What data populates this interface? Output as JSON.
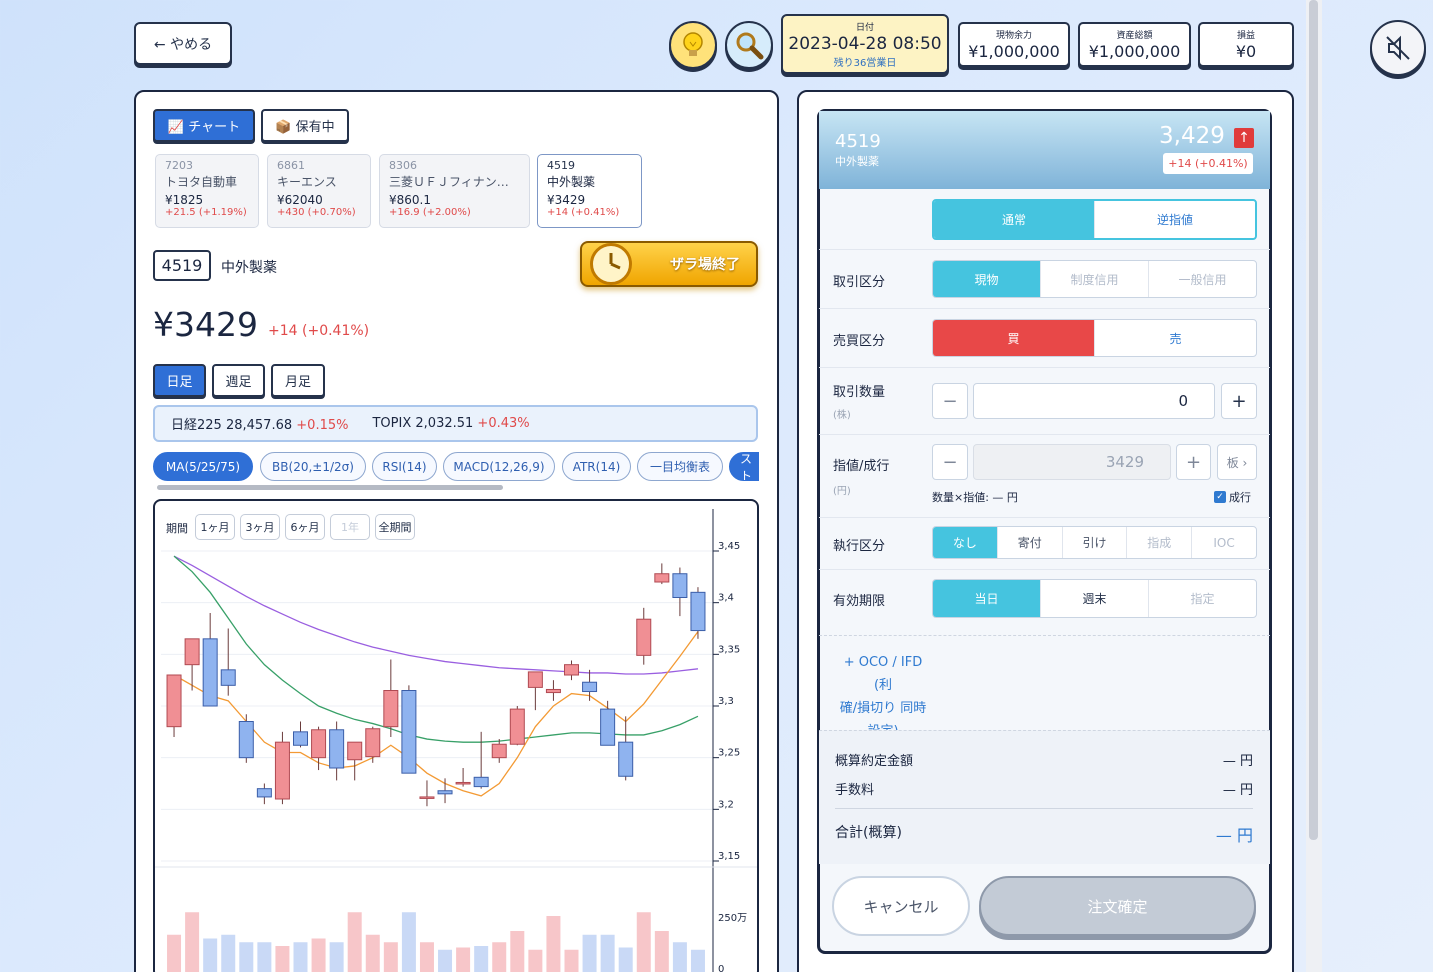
{
  "header": {
    "quit_label": "← やめる",
    "hint_icon": "lightbulb-icon",
    "search_icon": "magnifier-icon",
    "date_label": "日付",
    "date_value": "2023-04-28 08:50",
    "remaining": "残り36営業日",
    "cash_label": "現物余力",
    "cash_value": "¥1,000,000",
    "assets_label": "資産総額",
    "assets_value": "¥1,000,000",
    "pnl_label": "損益",
    "pnl_value": "¥0"
  },
  "left": {
    "tab_chart": "📈 チャート",
    "tab_holdings": "📦 保有中",
    "tickers": [
      {
        "code": "7203",
        "name": "トヨタ自動車",
        "price": "¥1825",
        "change": "+21.5 (+1.19%)"
      },
      {
        "code": "6861",
        "name": "キーエンス",
        "price": "¥62040",
        "change": "+430 (+0.70%)"
      },
      {
        "code": "8306",
        "name": "三菱ＵＦＪフィナン…",
        "price": "¥860.1",
        "change": "+16.9 (+2.00%)"
      },
      {
        "code": "4519",
        "name": "中外製薬",
        "price": "¥3429",
        "change": "+14 (+0.41%)"
      }
    ],
    "code": "4519",
    "name": "中外製薬",
    "market_closed": "ザラ場終了",
    "price": "¥3429",
    "change": "+14 (+0.41%)",
    "periods": [
      "日足",
      "週足",
      "月足"
    ],
    "index_nikkei_label": "日経225",
    "index_nikkei_value": "28,457.68",
    "index_nikkei_change": "+0.15%",
    "index_topix_label": "TOPIX",
    "index_topix_value": "2,032.51",
    "index_topix_change": "+0.43%",
    "indicators": [
      "MA(5/25/75)",
      "BB(20,±1/2σ)",
      "RSI(14)",
      "MACD(12,26,9)",
      "ATR(14)",
      "一目均衡表",
      "スト"
    ],
    "range_label": "期間",
    "ranges": [
      "1ヶ月",
      "3ヶ月",
      "6ヶ月",
      "1年",
      "全期間"
    ]
  },
  "chart_data": {
    "type": "candlestick",
    "y_ticks": [
      "3,45",
      "3,4",
      "3,35",
      "3,3",
      "3,25",
      "3,2",
      "3,15"
    ],
    "volume_ticks": [
      "250万",
      "0"
    ],
    "ylim": [
      3150,
      3450
    ],
    "candles": [
      {
        "o": 3280,
        "h": 3310,
        "l": 3270,
        "c": 3330
      },
      {
        "o": 3340,
        "h": 3360,
        "l": 3315,
        "c": 3365
      },
      {
        "o": 3365,
        "h": 3390,
        "l": 3300,
        "c": 3300
      },
      {
        "o": 3335,
        "h": 3375,
        "l": 3310,
        "c": 3320
      },
      {
        "o": 3285,
        "h": 3292,
        "l": 3245,
        "c": 3250
      },
      {
        "o": 3220,
        "h": 3225,
        "l": 3205,
        "c": 3212
      },
      {
        "o": 3210,
        "h": 3275,
        "l": 3205,
        "c": 3265
      },
      {
        "o": 3275,
        "h": 3285,
        "l": 3260,
        "c": 3262
      },
      {
        "o": 3250,
        "h": 3280,
        "l": 3238,
        "c": 3277
      },
      {
        "o": 3277,
        "h": 3285,
        "l": 3228,
        "c": 3240
      },
      {
        "o": 3248,
        "h": 3262,
        "l": 3228,
        "c": 3265
      },
      {
        "o": 3251,
        "h": 3280,
        "l": 3245,
        "c": 3278
      },
      {
        "o": 3280,
        "h": 3345,
        "l": 3270,
        "c": 3315
      },
      {
        "o": 3315,
        "h": 3320,
        "l": 3235,
        "c": 3235
      },
      {
        "o": 3212,
        "h": 3228,
        "l": 3203,
        "c": 3212
      },
      {
        "o": 3218,
        "h": 3230,
        "l": 3206,
        "c": 3215
      },
      {
        "o": 3225,
        "h": 3240,
        "l": 3222,
        "c": 3226
      },
      {
        "o": 3231,
        "h": 3275,
        "l": 3220,
        "c": 3222
      },
      {
        "o": 3250,
        "h": 3268,
        "l": 3245,
        "c": 3263
      },
      {
        "o": 3263,
        "h": 3300,
        "l": 3262,
        "c": 3297
      },
      {
        "o": 3318,
        "h": 3330,
        "l": 3296,
        "c": 3333
      },
      {
        "o": 3313,
        "h": 3325,
        "l": 3305,
        "c": 3316
      },
      {
        "o": 3330,
        "h": 3344,
        "l": 3325,
        "c": 3340
      },
      {
        "o": 3323,
        "h": 3335,
        "l": 3305,
        "c": 3314
      },
      {
        "o": 3297,
        "h": 3305,
        "l": 3262,
        "c": 3262
      },
      {
        "o": 3265,
        "h": 3290,
        "l": 3228,
        "c": 3232
      },
      {
        "o": 3349,
        "h": 3395,
        "l": 3340,
        "c": 3384
      },
      {
        "o": 3420,
        "h": 3438,
        "l": 3418,
        "c": 3428
      },
      {
        "o": 3428,
        "h": 3434,
        "l": 3387,
        "c": 3405
      },
      {
        "o": 3410,
        "h": 3415,
        "l": 3365,
        "c": 3373
      }
    ],
    "ma_long": [
      3445,
      3436,
      3426,
      3416,
      3406,
      3397,
      3389,
      3381,
      3374,
      3368,
      3362,
      3357,
      3353,
      3349,
      3346,
      3343,
      3341,
      3339,
      3337,
      3336,
      3335,
      3334,
      3333,
      3332,
      3332,
      3331,
      3331,
      3332,
      3334,
      3336
    ],
    "ma_mid": [
      3445,
      3430,
      3410,
      3385,
      3360,
      3340,
      3325,
      3312,
      3300,
      3293,
      3287,
      3283,
      3278,
      3272,
      3268,
      3266,
      3265,
      3265,
      3266,
      3268,
      3270,
      3272,
      3274,
      3274,
      3273,
      3272,
      3272,
      3276,
      3282,
      3290
    ],
    "ma_short": [
      3330,
      3320,
      3310,
      3305,
      3285,
      3265,
      3255,
      3255,
      3245,
      3240,
      3242,
      3250,
      3262,
      3250,
      3235,
      3225,
      3218,
      3213,
      3225,
      3250,
      3280,
      3300,
      3312,
      3310,
      3298,
      3285,
      3302,
      3325,
      3348,
      3372
    ],
    "volume": [
      0.55,
      0.85,
      0.5,
      0.55,
      0.45,
      0.45,
      0.4,
      0.45,
      0.5,
      0.45,
      0.85,
      0.55,
      0.45,
      0.85,
      0.45,
      0.35,
      0.38,
      0.4,
      0.45,
      0.6,
      0.35,
      0.8,
      0.35,
      0.55,
      0.55,
      0.38,
      0.85,
      0.6,
      0.45,
      0.35
    ],
    "colors": {
      "up": "#f08f94",
      "down": "#8fb3ef",
      "ma_long": "#9a5fe0",
      "ma_mid": "#38a068",
      "ma_short": "#f39a34",
      "vol_up": "#f7c6c9",
      "vol_down": "#c9d9f6"
    }
  },
  "order": {
    "code": "4519",
    "name": "中外製薬",
    "price": "3,429",
    "change": "+14 (+0.41%)",
    "order_type": [
      "通常",
      "逆指値"
    ],
    "trade_label": "取引区分",
    "trade_options": [
      "現物",
      "制度信用",
      "一般信用"
    ],
    "side_label": "売買区分",
    "side_buy": "買",
    "side_sell": "売",
    "qty_label": "取引数量",
    "qty_unit": "(株)",
    "qty_value": "0",
    "price_label": "指値/成行",
    "price_unit": "(円)",
    "price_value": "3429",
    "board": "板 ›",
    "calc": "数量×指値: — 円",
    "market_order": "成行",
    "exec_label": "執行区分",
    "exec_options": [
      "なし",
      "寄付",
      "引け",
      "指成",
      "IOC"
    ],
    "expiry_label": "有効期限",
    "expiry_options": [
      "当日",
      "週末",
      "指定"
    ],
    "oco_line1": "+ OCO / IFD (利",
    "oco_line2": "確/損切り 同時",
    "oco_line3": "設定)",
    "est_amount_label": "概算約定金額",
    "est_amount_value": "— 円",
    "fee_label": "手数料",
    "fee_value": "— 円",
    "total_label": "合計(概算)",
    "total_value": "— 円",
    "cancel": "キャンセル",
    "confirm": "注文確定"
  }
}
